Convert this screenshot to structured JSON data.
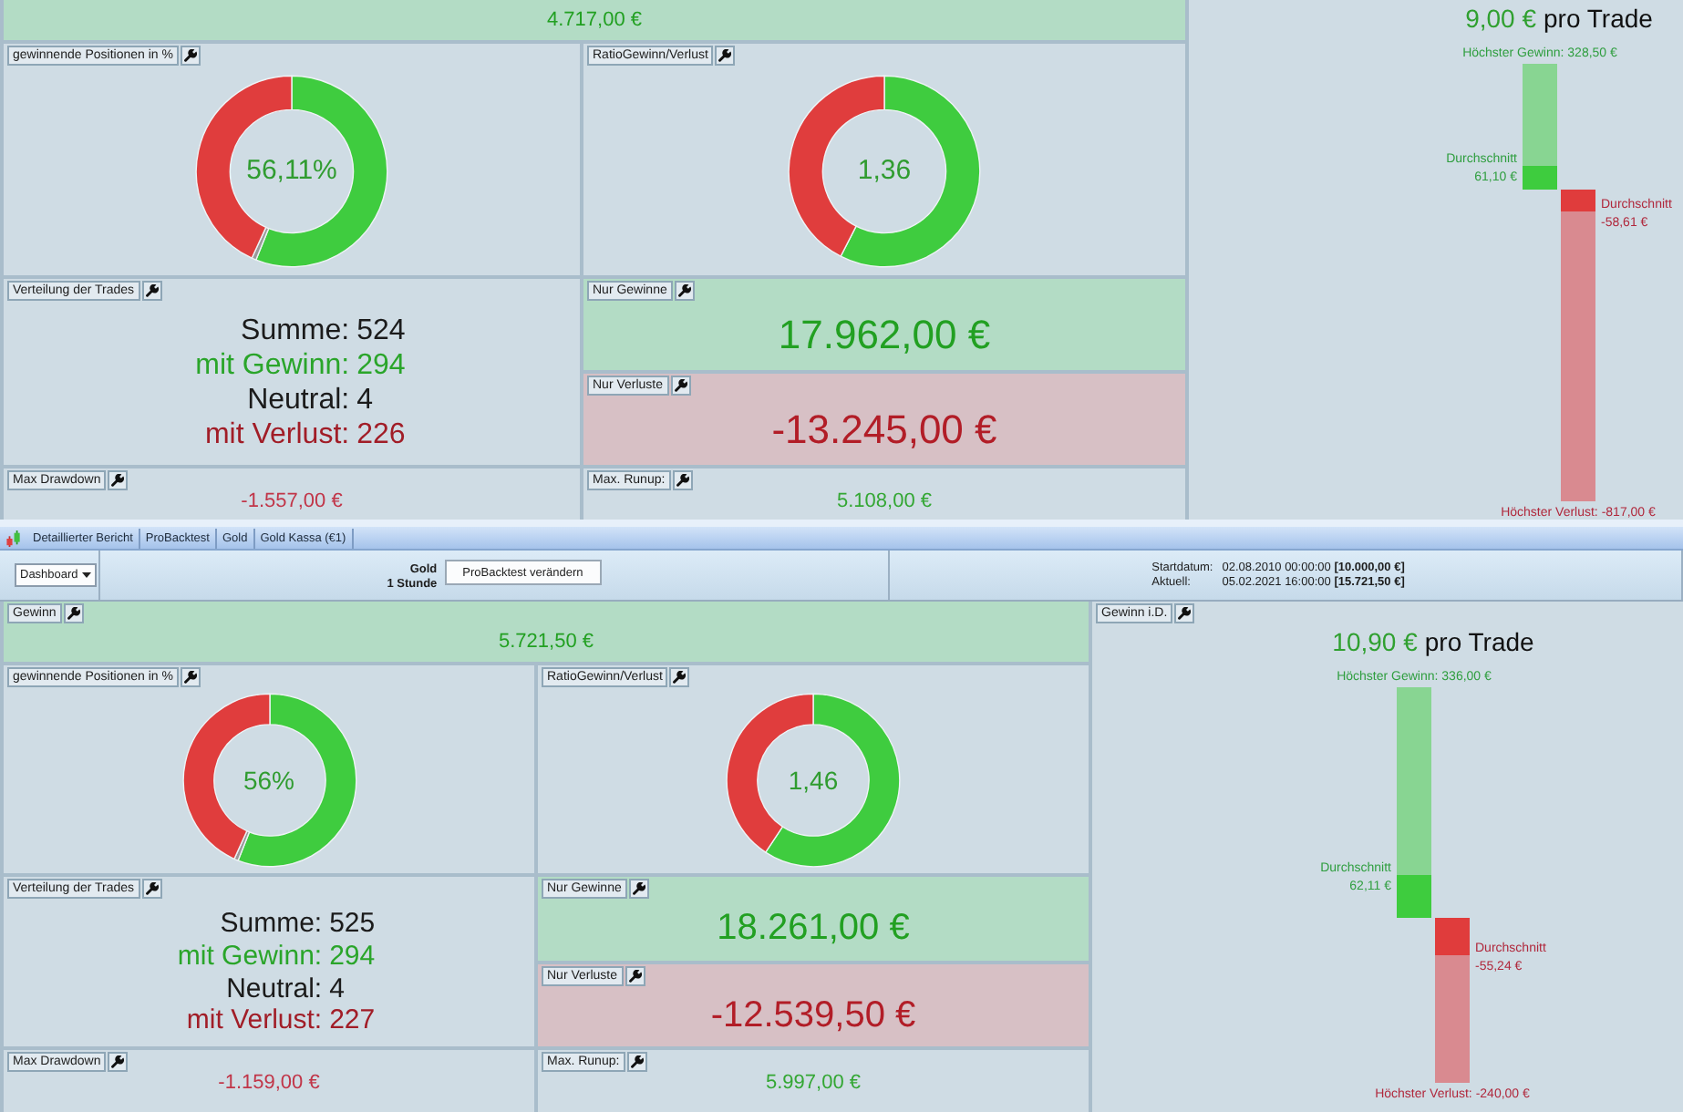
{
  "dashboard_top": {
    "summary": {
      "value": "4.717,00 €",
      "kind": "gain"
    },
    "win_rate": {
      "title": "gewinnende Positionen in %",
      "center_label": "56,11%",
      "chart_data": {
        "type": "donut",
        "values": [
          56.11,
          0.76,
          43.13
        ]
      }
    },
    "ratio": {
      "title": "RatioGewinn/Verlust",
      "center_label": "1,36",
      "chart_data": {
        "type": "donut",
        "values": [
          57.56,
          42.44
        ]
      }
    },
    "distribution": {
      "title": "Verteilung der Trades",
      "lines": [
        {
          "label": "Summe:",
          "value": "524",
          "color": "#1b1b1b"
        },
        {
          "label": "mit Gewinn:",
          "value": "294",
          "color": "#2aa52a"
        },
        {
          "label": "Neutral:",
          "value": "4",
          "color": "#1b1b1b"
        },
        {
          "label": "mit Verlust:",
          "value": "226",
          "color": "#a11d27"
        }
      ]
    },
    "totals": [
      {
        "title": "Nur Gewinne",
        "value": "17.962,00 €",
        "kind": "gain"
      },
      {
        "title": "Nur Verluste",
        "value": "-13.245,00 €",
        "kind": "loss"
      }
    ],
    "drawdown": {
      "title": "Max Drawdown",
      "value": "-1.557,00 €",
      "kind": "loss"
    },
    "runup": {
      "title": "Max. Runup:",
      "value": "5.108,00 €",
      "kind": "gain"
    },
    "per_trade": {
      "value": "9,00 €",
      "suffix": "pro Trade",
      "highest_gain": "Höchster Gewinn: 328,50 €",
      "average_gain_label": "Durchschnitt",
      "average_gain": "61,10 €",
      "average_loss_label": "Durchschnitt",
      "average_loss": "-58,61 €",
      "highest_loss": "Höchster Verlust: -817,00 €"
    }
  },
  "window": {
    "breadcrumb": [
      "Detaillierter Bericht",
      "ProBacktest",
      "Gold",
      "Gold Kassa (€1)"
    ]
  },
  "toolbar": {
    "view": "Dashboard",
    "instrument": "Gold",
    "timeframe": "1 Stunde",
    "edit_button": "ProBacktest verändern",
    "dates": [
      {
        "label": "Startdatum:",
        "value": "02.08.2010 00:00:00 **[10.000,00 €]**"
      },
      {
        "label": "Aktuell:",
        "value": "05.02.2021 16:00:00 **[15.721,50 €]**"
      }
    ]
  },
  "dashboard": {
    "summary": {
      "title": "Gewinn",
      "value": "5.721,50 €",
      "kind": "gain"
    },
    "win_rate": {
      "title": "gewinnende Positionen in %",
      "center_label": "56%",
      "chart_data": {
        "type": "donut",
        "values": [
          56.0,
          0.76,
          43.24
        ]
      }
    },
    "ratio": {
      "title": "RatioGewinn/Verlust",
      "center_label": "1,46",
      "chart_data": {
        "type": "donut",
        "values": [
          59.29,
          40.71
        ]
      }
    },
    "distribution": {
      "title": "Verteilung der Trades",
      "lines": [
        {
          "label": "Summe:",
          "value": "525",
          "color": "#1b1b1b"
        },
        {
          "label": "mit Gewinn:",
          "value": "294",
          "color": "#2aa52a"
        },
        {
          "label": "Neutral:",
          "value": "4",
          "color": "#1b1b1b"
        },
        {
          "label": "mit Verlust:",
          "value": "227",
          "color": "#a11d27"
        }
      ]
    },
    "totals": [
      {
        "title": "Nur Gewinne",
        "value": "18.261,00 €",
        "kind": "gain"
      },
      {
        "title": "Nur Verluste",
        "value": "-12.539,50 €",
        "kind": "loss"
      }
    ],
    "drawdown": {
      "title": "Max Drawdown",
      "value": "-1.159,00 €",
      "kind": "loss"
    },
    "runup": {
      "title": "Max. Runup:",
      "value": "5.997,00 €",
      "kind": "gain"
    },
    "per_trade": {
      "title": "Gewinn i.D.",
      "value": "10,90 €",
      "suffix": "pro Trade",
      "highest_gain": "Höchster Gewinn: 336,00 €",
      "average_gain_label": "Durchschnitt",
      "average_gain": "62,11 €",
      "average_loss_label": "Durchschnitt",
      "average_loss": "-55,24 €",
      "highest_loss": "Höchster Verlust: -240,00 €"
    }
  }
}
